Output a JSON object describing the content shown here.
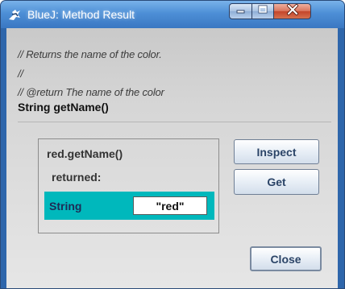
{
  "window": {
    "title": "BlueJ:  Method Result",
    "icon": "bluej-app-icon",
    "controls": {
      "minimize": "minimize-icon",
      "maximize": "maximize-icon",
      "close": "close-icon"
    }
  },
  "doc": {
    "comment_lines": [
      "// Returns the name of the color.",
      "//",
      "// @return The name of the color"
    ],
    "signature": "String getName()"
  },
  "result": {
    "call": "red.getName()",
    "returned_label": "returned:",
    "type": "String",
    "value": "\"red\"",
    "highlight_color": "#00b8bc"
  },
  "buttons": {
    "inspect": "Inspect",
    "get": "Get",
    "close": "Close"
  }
}
